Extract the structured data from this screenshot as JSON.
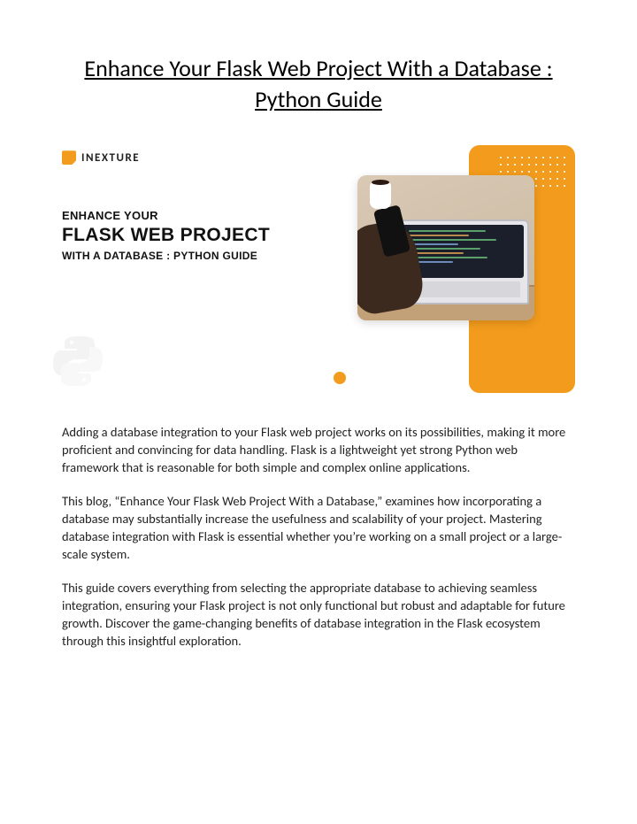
{
  "title": "Enhance Your Flask Web Project With a Database : Python Guide",
  "brand": "INEXTURE",
  "hero": {
    "line1": "ENHANCE YOUR",
    "line2": "FLASK WEB PROJECT",
    "line3": "WITH A DATABASE : PYTHON GUIDE"
  },
  "paragraphs": [
    "Adding a database integration to your Flask web project works on its possibilities, making it more proficient and convincing for data handling. Flask is a lightweight yet strong Python web framework that is reasonable for both simple and complex online applications.",
    "This blog, “Enhance Your Flask Web Project With a Database,” examines how incorporating a database may substantially increase the usefulness and scalability of your project. Mastering database integration with Flask is essential whether you’re working on a small project or a large-scale system.",
    "This guide covers everything from selecting the appropriate database to achieving seamless integration, ensuring your Flask project is not only functional but robust and adaptable for future growth. Discover the game-changing benefits of database integration in the Flask ecosystem through this insightful exploration."
  ]
}
